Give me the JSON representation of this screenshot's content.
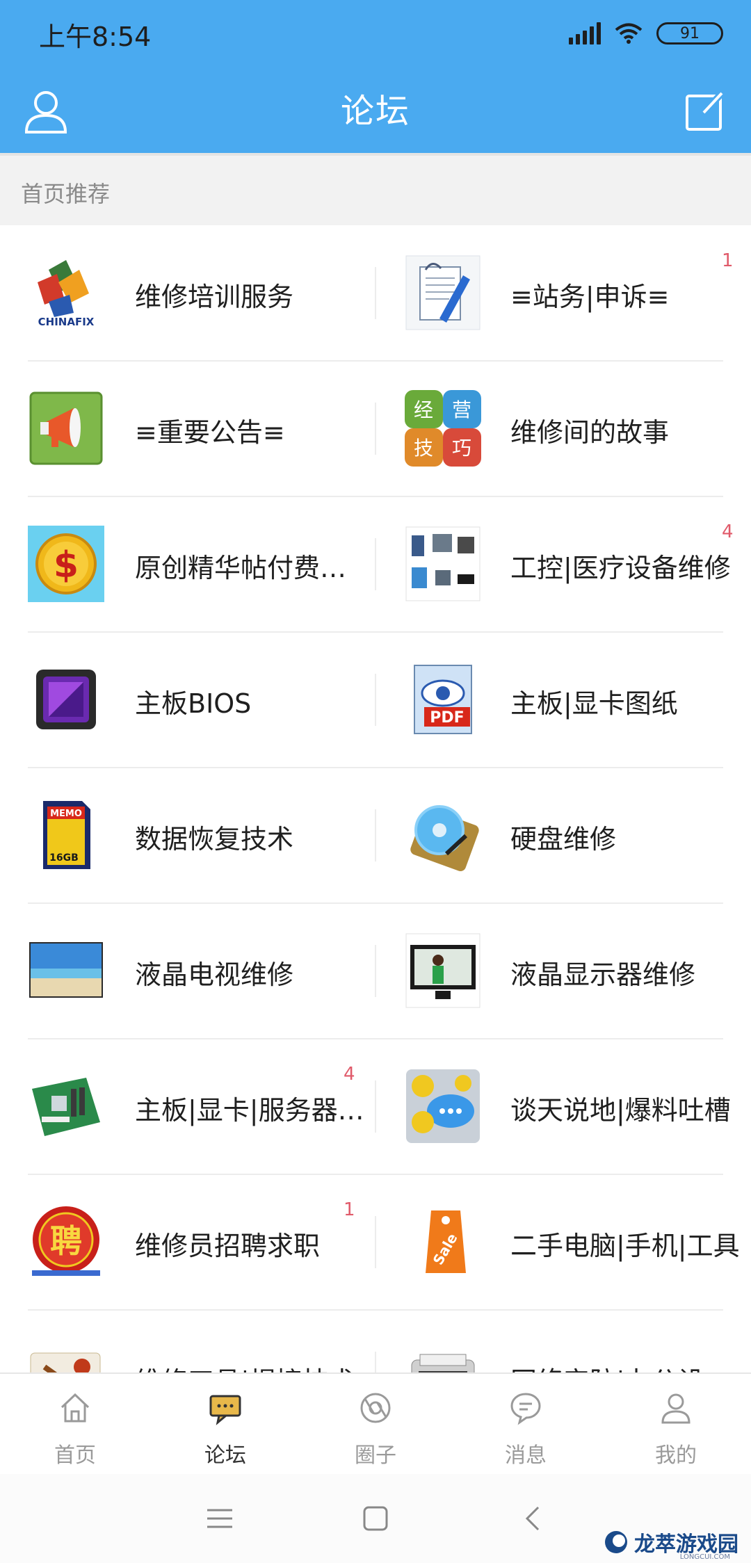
{
  "status_bar": {
    "time": "上午8:54",
    "battery": "91"
  },
  "app_bar": {
    "title": "论坛"
  },
  "section": {
    "title": "首页推荐"
  },
  "forums": [
    {
      "name": "维修培训服务",
      "badge": "",
      "icon": "chinafix-logo-icon"
    },
    {
      "name": "≡站务|申诉≡",
      "badge": "1",
      "icon": "document-pen-icon"
    },
    {
      "name": "≡重要公告≡",
      "badge": "",
      "icon": "megaphone-icon"
    },
    {
      "name": "维修间的故事",
      "badge": "",
      "icon": "business-tips-icon",
      "icon_text": [
        "经",
        "营",
        "技",
        "巧"
      ]
    },
    {
      "name": "原创精华帖付费…",
      "badge": "",
      "icon": "dollar-coin-icon"
    },
    {
      "name": "工控|医疗设备维修",
      "badge": "4",
      "icon": "equipment-icon"
    },
    {
      "name": "主板BIOS",
      "badge": "",
      "icon": "chip-icon"
    },
    {
      "name": "主板|显卡图纸",
      "badge": "",
      "icon": "pdf-eye-icon",
      "icon_text": [
        "PDF"
      ]
    },
    {
      "name": "数据恢复技术",
      "badge": "",
      "icon": "memory-card-icon",
      "icon_text": [
        "MEMO",
        "16GB"
      ]
    },
    {
      "name": "硬盘维修",
      "badge": "",
      "icon": "hard-disk-icon"
    },
    {
      "name": "液晶电视维修",
      "badge": "",
      "icon": "lcd-tv-icon"
    },
    {
      "name": "液晶显示器维修",
      "badge": "",
      "icon": "monitor-icon"
    },
    {
      "name": "主板|显卡|服务器…",
      "badge": "4",
      "icon": "motherboard-icon"
    },
    {
      "name": "谈天说地|爆料吐槽",
      "badge": "",
      "icon": "chat-bubbles-icon"
    },
    {
      "name": "维修员招聘求职",
      "badge": "1",
      "icon": "recruit-seal-icon",
      "icon_text": [
        "聘"
      ]
    },
    {
      "name": "二手电脑|手机|工具",
      "badge": "",
      "icon": "sale-tag-icon",
      "icon_text": [
        "Sale"
      ]
    },
    {
      "name": "维修工具|焊接技术",
      "badge": "",
      "icon": "tools-icon"
    },
    {
      "name": "网络安防|办公设",
      "badge": "",
      "icon": "printer-icon"
    }
  ],
  "tabs": [
    {
      "label": "首页",
      "icon": "home-icon",
      "active": false
    },
    {
      "label": "论坛",
      "icon": "forum-icon",
      "active": true
    },
    {
      "label": "圈子",
      "icon": "circle-icon",
      "active": false
    },
    {
      "label": "消息",
      "icon": "message-icon",
      "active": false
    },
    {
      "label": "我的",
      "icon": "profile-icon",
      "active": false
    }
  ],
  "watermark": {
    "text": "龙萃游戏园",
    "sub": "LONGCUI.COM"
  },
  "colors": {
    "primary": "#4aaaf0",
    "badge": "#e05a6a",
    "active_tab_icon": "#e8b84a"
  }
}
